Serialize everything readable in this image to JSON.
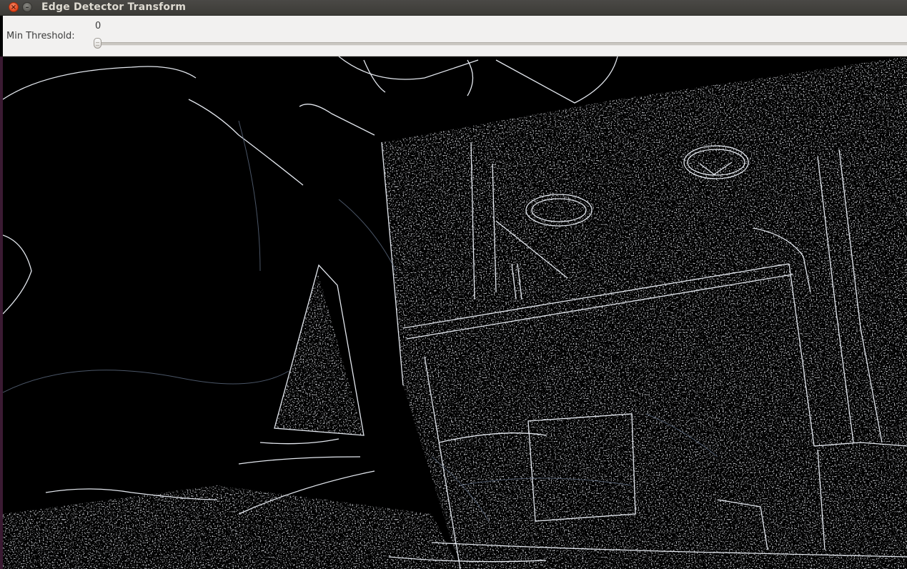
{
  "window": {
    "title": "Edge Detector Transform"
  },
  "titlebar_buttons": {
    "close_icon": "close-icon",
    "minimize_icon": "minimize-icon"
  },
  "controls": {
    "min_threshold_label": "Min Threshold:",
    "min_threshold_value": "0",
    "min_threshold_fraction": 0
  },
  "canvas": {
    "content": "edge-detected output image",
    "background_color": "#000000",
    "edge_color": "#d8dde8"
  }
}
